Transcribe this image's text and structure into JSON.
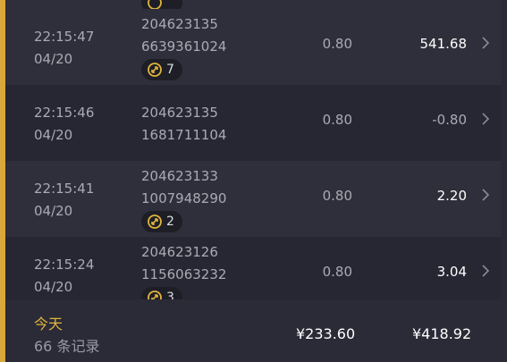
{
  "rows": [
    {
      "time": "",
      "date": "",
      "id1": "",
      "id2": "",
      "fee": "",
      "amount": "",
      "badge": ""
    },
    {
      "time": "22:15:47",
      "date": "04/20",
      "id1": "204623135",
      "id2": "6639361024",
      "fee": "0.80",
      "amount": "541.68",
      "badge": "7"
    },
    {
      "time": "22:15:46",
      "date": "04/20",
      "id1": "204623135",
      "id2": "1681711104",
      "fee": "0.80",
      "amount": "-0.80",
      "badge": ""
    },
    {
      "time": "22:15:41",
      "date": "04/20",
      "id1": "204623133",
      "id2": "1007948290",
      "fee": "0.80",
      "amount": "2.20",
      "badge": "2"
    },
    {
      "time": "22:15:24",
      "date": "04/20",
      "id1": "204623126",
      "id2": "1156063232",
      "fee": "0.80",
      "amount": "3.04",
      "badge": "3"
    }
  ],
  "footer": {
    "today_label": "今天",
    "count_label": "66 条记录",
    "total_fee": "¥233.60",
    "total_amount": "¥418.92"
  },
  "colors": {
    "accent": "#e0b43c",
    "row_dark": "#272733",
    "row_light": "#2f2f3b"
  },
  "icons": {
    "badge": "refresh-circle-icon",
    "chevron": "chevron-right-icon"
  }
}
